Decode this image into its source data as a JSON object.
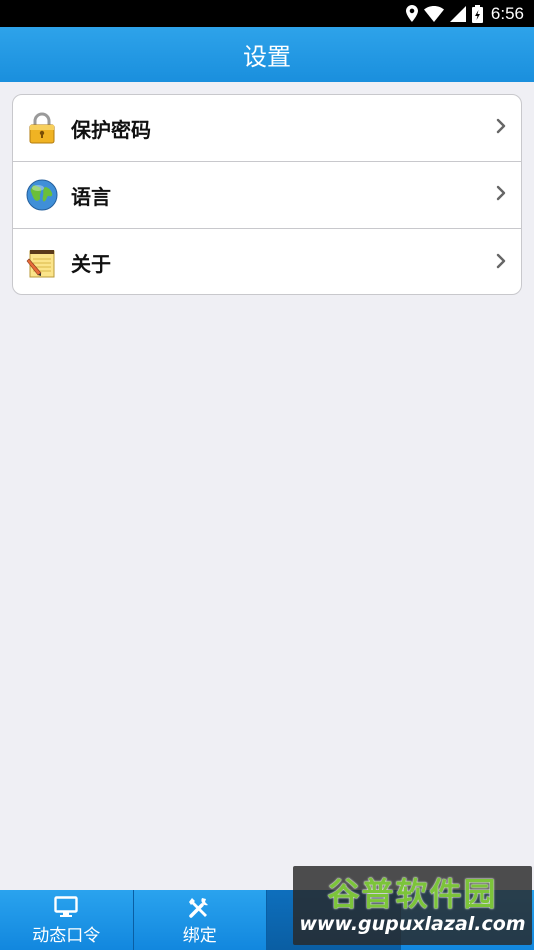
{
  "status_bar": {
    "time": "6:56"
  },
  "header": {
    "title": "设置"
  },
  "settings": {
    "items": [
      {
        "label": "保护密码",
        "icon": "padlock-icon"
      },
      {
        "label": "语言",
        "icon": "globe-icon"
      },
      {
        "label": "关于",
        "icon": "notepad-icon"
      }
    ]
  },
  "tabs": [
    {
      "label": "动态口令",
      "icon": "monitor-icon"
    },
    {
      "label": "绑定",
      "icon": "tools-icon"
    },
    {
      "label": "",
      "icon": "settings-icon"
    },
    {
      "label": "",
      "icon": "more-icon"
    }
  ],
  "watermark": {
    "title": "谷普软件园",
    "url": "www.gupuxlazal.com"
  },
  "colors": {
    "primary": "#1a8fdd",
    "background": "#efeff4",
    "tab_active": "#0a5ea3"
  }
}
